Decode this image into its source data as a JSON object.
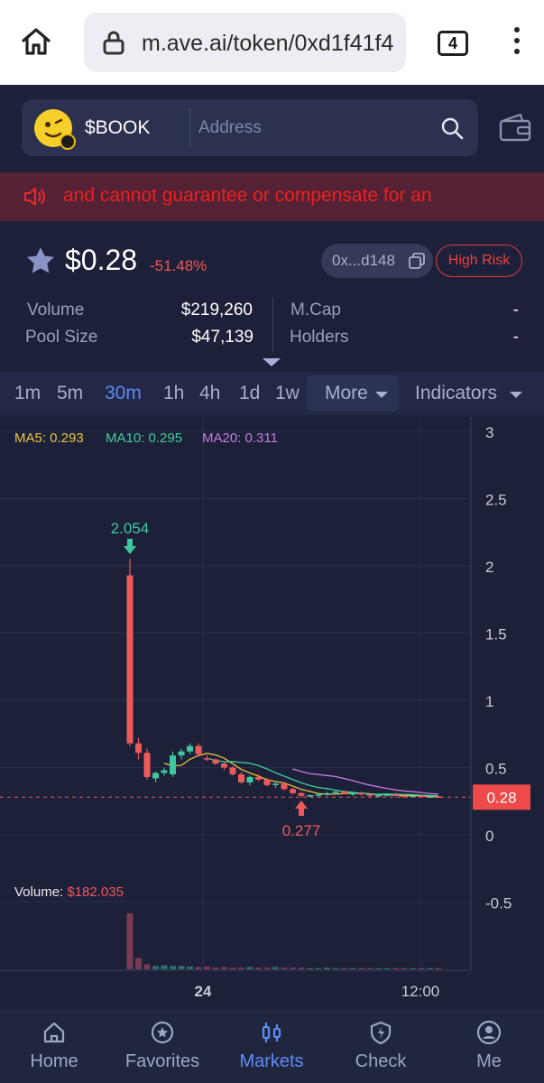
{
  "browser": {
    "url": "m.ave.ai/token/0xd1f41f4",
    "tab_count": "4"
  },
  "header": {
    "token_symbol": "$BOOK",
    "address_placeholder": "Address"
  },
  "notice": {
    "text": "and cannot guarantee or compensate for an"
  },
  "token": {
    "price": "$0.28",
    "change": "-51.48%",
    "address_short": "0x...d148",
    "risk_label": "High Risk"
  },
  "stats": {
    "volume_label": "Volume",
    "volume_value": "$219,260",
    "pool_label": "Pool Size",
    "pool_value": "$47,139",
    "mcap_label": "M.Cap",
    "mcap_value": "-",
    "holders_label": "Holders",
    "holders_value": "-"
  },
  "intervals": {
    "items": [
      "1m",
      "5m",
      "30m",
      "1h",
      "4h",
      "1d",
      "1w"
    ],
    "active": "30m",
    "more_label": "More",
    "indicators_label": "Indicators"
  },
  "indicators": {
    "ma5": "MA5: 0.293",
    "ma10": "MA10: 0.295",
    "ma20": "MA20: 0.311",
    "ma5_color": "#e9c53c",
    "ma10_color": "#3fcf9a",
    "ma20_color": "#c77de0"
  },
  "chart_data": {
    "type": "candlestick",
    "y_ticks": [
      "3",
      "2.5",
      "2",
      "1.5",
      "1",
      "0.5",
      "0",
      "-0.5"
    ],
    "y_ticks_values": [
      3,
      2.5,
      2,
      1.5,
      1,
      0.5,
      0,
      -0.5
    ],
    "x_ticks": [
      "24",
      "12:00"
    ],
    "current_price_label": "0.28",
    "current_price": 0.28,
    "high_label": "2.054",
    "high": 2.054,
    "low_label": "0.277",
    "low": 0.277,
    "volume_label": "Volume:",
    "volume_value": "$182.035",
    "up_color": "#3fc7a0",
    "down_color": "#ee5a5a",
    "candles": [
      [
        1.93,
        2.054,
        0.66,
        0.68
      ],
      [
        0.68,
        0.72,
        0.56,
        0.61
      ],
      [
        0.61,
        0.64,
        0.41,
        0.43
      ],
      [
        0.42,
        0.47,
        0.39,
        0.46
      ],
      [
        0.46,
        0.5,
        0.44,
        0.48
      ],
      [
        0.45,
        0.62,
        0.43,
        0.59
      ],
      [
        0.59,
        0.64,
        0.56,
        0.62
      ],
      [
        0.62,
        0.68,
        0.6,
        0.66
      ],
      [
        0.66,
        0.68,
        0.58,
        0.6
      ],
      [
        0.57,
        0.59,
        0.55,
        0.56
      ],
      [
        0.56,
        0.57,
        0.52,
        0.53
      ],
      [
        0.53,
        0.54,
        0.48,
        0.5
      ],
      [
        0.5,
        0.51,
        0.44,
        0.45
      ],
      [
        0.45,
        0.47,
        0.38,
        0.39
      ],
      [
        0.39,
        0.44,
        0.37,
        0.43
      ],
      [
        0.43,
        0.45,
        0.4,
        0.41
      ],
      [
        0.41,
        0.42,
        0.36,
        0.37
      ],
      [
        0.37,
        0.39,
        0.35,
        0.38
      ],
      [
        0.38,
        0.39,
        0.33,
        0.34
      ],
      [
        0.34,
        0.35,
        0.3,
        0.31
      ],
      [
        0.31,
        0.32,
        0.277,
        0.29
      ],
      [
        0.29,
        0.3,
        0.28,
        0.295
      ],
      [
        0.295,
        0.31,
        0.285,
        0.3
      ],
      [
        0.3,
        0.32,
        0.29,
        0.31
      ],
      [
        0.31,
        0.33,
        0.3,
        0.32
      ],
      [
        0.32,
        0.33,
        0.3,
        0.305
      ],
      [
        0.305,
        0.32,
        0.29,
        0.31
      ],
      [
        0.31,
        0.32,
        0.29,
        0.3
      ],
      [
        0.3,
        0.31,
        0.28,
        0.29
      ],
      [
        0.29,
        0.3,
        0.28,
        0.295
      ],
      [
        0.295,
        0.31,
        0.285,
        0.3
      ],
      [
        0.3,
        0.31,
        0.28,
        0.29
      ],
      [
        0.29,
        0.3,
        0.28,
        0.285
      ],
      [
        0.285,
        0.3,
        0.28,
        0.29
      ],
      [
        0.29,
        0.3,
        0.278,
        0.28
      ],
      [
        0.28,
        0.29,
        0.275,
        0.285
      ],
      [
        0.285,
        0.29,
        0.278,
        0.28
      ]
    ],
    "volumes": [
      100,
      20,
      9,
      6,
      7,
      6,
      6,
      5,
      4,
      5,
      3,
      4,
      3,
      3,
      4,
      3,
      3,
      4,
      3,
      3,
      3,
      2,
      2,
      3,
      2,
      2,
      2,
      2,
      2,
      2,
      2,
      2,
      2,
      2,
      2,
      2,
      2
    ]
  },
  "nav": {
    "items": [
      {
        "label": "Home",
        "icon": "home-icon",
        "active": false
      },
      {
        "label": "Favorites",
        "icon": "favorites-icon",
        "active": false
      },
      {
        "label": "Markets",
        "icon": "markets-icon",
        "active": true
      },
      {
        "label": "Check",
        "icon": "check-icon",
        "active": false
      },
      {
        "label": "Me",
        "icon": "me-icon",
        "active": false
      }
    ]
  }
}
